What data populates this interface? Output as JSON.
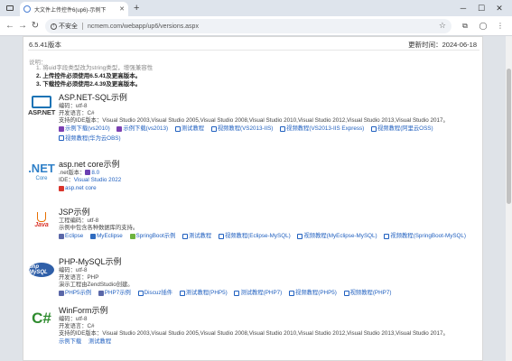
{
  "browser": {
    "tab_title": "大文件上传控件6(up6)-示例下",
    "url": "ncmem.com/webapp/up6/versions.aspx",
    "security_label": "不安全"
  },
  "header": {
    "version": "6.5.41版本",
    "updated": "更新时间：2024-06-18"
  },
  "notes": {
    "title": "说明：",
    "items": [
      "1. 将uid字段类型改为string类型，增强兼容性",
      "2. 上传控件必须使用6.5.41及更高版本。",
      "3. 下载控件必须使用2.4.39及更高版本。"
    ]
  },
  "sections": [
    {
      "title": "ASP.NET-SQL示例",
      "logo_text": "ASP.NET",
      "meta": [
        "编码：utf-8",
        "开发语言：C#",
        "支持的IDE版本：Visual Studio 2003,Visual Studio 2005,Visual Studio 2008,Visual Studio 2010,Visual Studio 2012,Visual Studio 2013,Visual Studio 2017。"
      ],
      "links1": [
        "示例下载(vs2010)",
        "示例下载(vs2013)",
        "测试教程",
        "视频教程(VS2013-IIS)",
        "视频教程(VS2013-IIS Express)",
        "视频教程(阿里云OSS)"
      ],
      "links2": [
        "视频教程(华为云OBS)"
      ]
    },
    {
      "title": "asp.net core示例",
      "logo_text_1": ".NET",
      "logo_text_2": "Core",
      "meta_1_label": ".net版本：",
      "meta_1_value": "8.0",
      "meta_2_label": "IDE：",
      "meta_2_value": "Visual Studio 2022",
      "links1": [
        "asp.net core"
      ]
    },
    {
      "title": "JSP示例",
      "logo_text": "Java",
      "meta": [
        "工程编码：utf-8",
        "示例中包含各种数据库的支持。"
      ],
      "links1": [
        "Eclipse",
        "MyEclipse",
        "SpringBoot示例",
        "测试教程",
        "视频教程(Eclipse-MySQL)",
        "视频教程(MyEclipse-MySQL)",
        "视频教程(SpringBoot-MySQL)"
      ]
    },
    {
      "title": "PHP-MySQL示例",
      "logo_text": "php MySQL",
      "meta": [
        "编码：utf-8",
        "开发语言：PHP",
        "演示工程由ZendStudio创建。"
      ],
      "links1": [
        "PHP5示例",
        "PHP7示例",
        "Discuz插件",
        "测试教程(PHP5)",
        "测试教程(PHP7)",
        "视频教程(PHP5)",
        "视频教程(PHP7)"
      ]
    },
    {
      "title": "WinForm示例",
      "logo_text": "C#",
      "meta": [
        "编码：utf-8",
        "开发语言：C#",
        "支持的IDE版本：Visual Studio 2003,Visual Studio 2005,Visual Studio 2008,Visual Studio 2010,Visual Studio 2012,Visual Studio 2013,Visual Studio 2017。"
      ],
      "links1": [
        "示例下载",
        "测试教程"
      ]
    }
  ]
}
